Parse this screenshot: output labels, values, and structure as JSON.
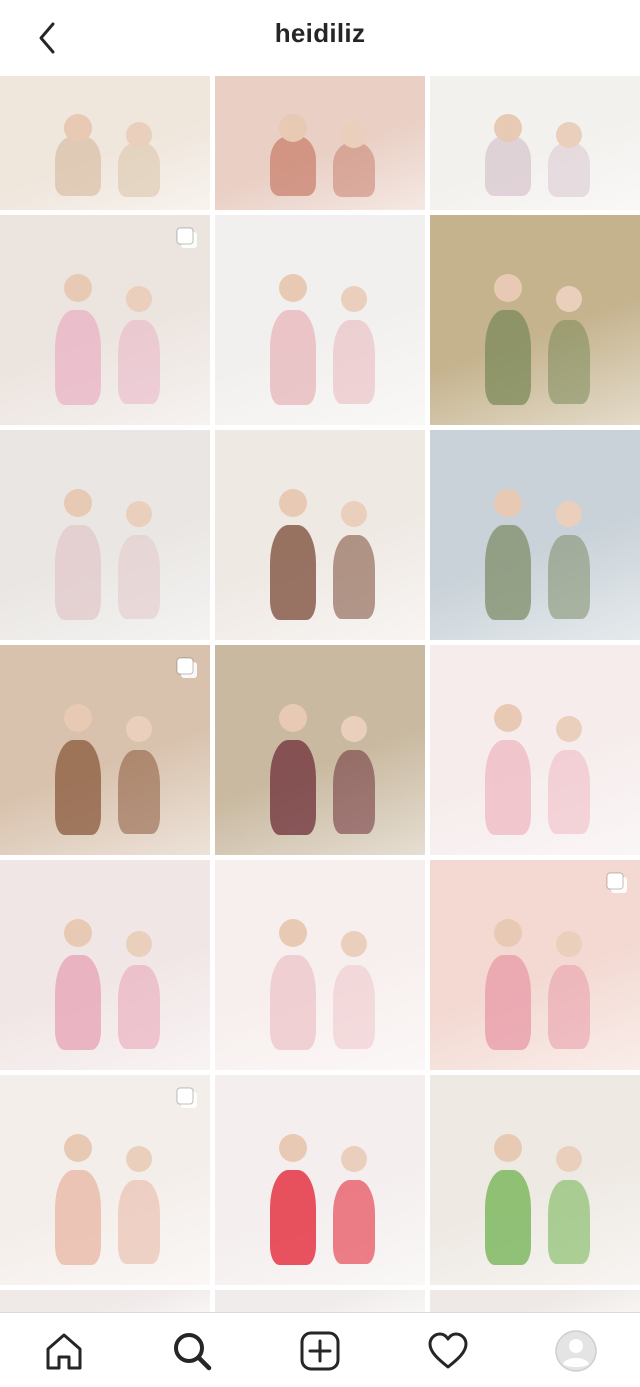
{
  "header": {
    "title": "heidiliz",
    "back_icon": "chevron-left-icon"
  },
  "grid": {
    "tiles": [
      {
        "bg": "#efe6dc",
        "accent": "#d9c2a8",
        "multi": false
      },
      {
        "bg": "#e9cfc4",
        "accent": "#c9826f",
        "multi": false
      },
      {
        "bg": "#f3f1ee",
        "accent": "#d8c7cf",
        "multi": false
      },
      {
        "bg": "#ece4df",
        "accent": "#e9b3c4",
        "multi": true
      },
      {
        "bg": "#f2f0ee",
        "accent": "#e7b6b9",
        "multi": false
      },
      {
        "bg": "#c5b38e",
        "accent": "#7b8a5a",
        "multi": false
      },
      {
        "bg": "#e9e6e3",
        "accent": "#e2c8c9",
        "multi": false
      },
      {
        "bg": "#efe9e4",
        "accent": "#7a4a35",
        "multi": false
      },
      {
        "bg": "#c9d2d8",
        "accent": "#7f8d6a",
        "multi": false
      },
      {
        "bg": "#d8c2ad",
        "accent": "#8a5a3c",
        "multi": true
      },
      {
        "bg": "#c9b9a0",
        "accent": "#6e2f38",
        "multi": false
      },
      {
        "bg": "#f6ecec",
        "accent": "#efb8c2",
        "multi": false
      },
      {
        "bg": "#f1e6e6",
        "accent": "#e7a2b5",
        "multi": false
      },
      {
        "bg": "#f7efee",
        "accent": "#eec4c8",
        "multi": false
      },
      {
        "bg": "#f3d9d2",
        "accent": "#e89aa7",
        "multi": true
      },
      {
        "bg": "#f4eeea",
        "accent": "#e8b5a3",
        "multi": true
      },
      {
        "bg": "#f4eeee",
        "accent": "#e21c2c",
        "multi": false
      },
      {
        "bg": "#eee9e3",
        "accent": "#6fb24f",
        "multi": false
      },
      {
        "bg": "#efe9e8",
        "accent": "#e8c8cc",
        "multi": false
      },
      {
        "bg": "#f0eceb",
        "accent": "#e3c1bd",
        "multi": false
      },
      {
        "bg": "#eee9e6",
        "accent": "#d7b8b0",
        "multi": false
      }
    ]
  },
  "nav": {
    "items": [
      {
        "name": "home-icon"
      },
      {
        "name": "search-icon"
      },
      {
        "name": "add-post-icon"
      },
      {
        "name": "heart-icon"
      },
      {
        "name": "profile-avatar-icon"
      }
    ]
  }
}
